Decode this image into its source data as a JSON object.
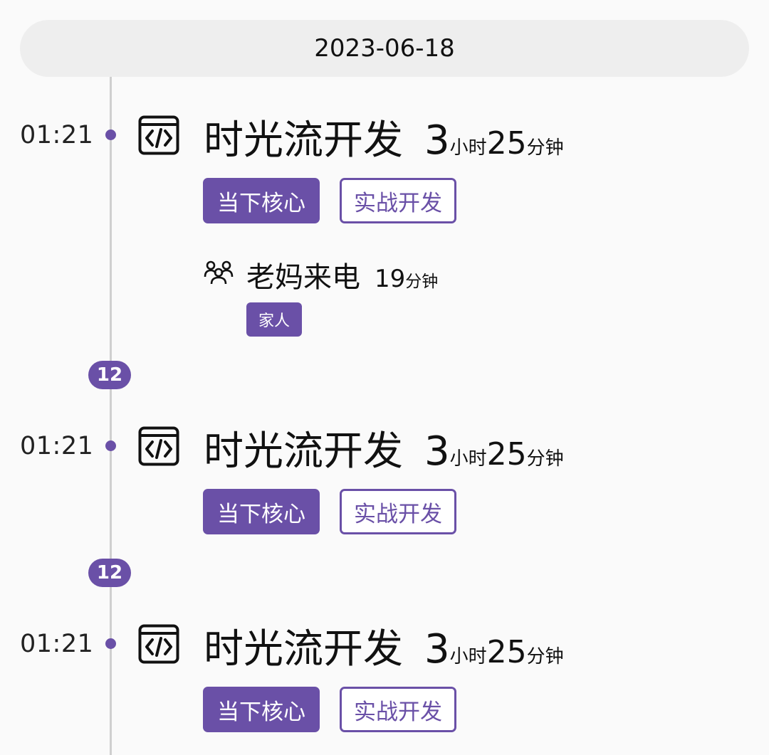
{
  "date_header": "2023-06-18",
  "entries": [
    {
      "time": "01:21",
      "icon": "code-window-icon",
      "title": "时光流开发",
      "duration_hours": "3",
      "hours_unit": "小时",
      "duration_minutes": "25",
      "minutes_unit": "分钟",
      "tags": [
        "当下核心",
        "实战开发"
      ],
      "sub_entry": {
        "icon": "people-icon",
        "title": "老妈来电",
        "duration_minutes": "19",
        "minutes_unit": "分钟",
        "tag": "家人"
      }
    },
    {
      "time": "01:21",
      "icon": "code-window-icon",
      "title": "时光流开发",
      "duration_hours": "3",
      "hours_unit": "小时",
      "duration_minutes": "25",
      "minutes_unit": "分钟",
      "tags": [
        "当下核心",
        "实战开发"
      ]
    },
    {
      "time": "01:21",
      "icon": "code-window-icon",
      "title": "时光流开发",
      "duration_hours": "3",
      "hours_unit": "小时",
      "duration_minutes": "25",
      "minutes_unit": "分钟",
      "tags": [
        "当下核心",
        "实战开发"
      ]
    }
  ],
  "gap_badges": [
    "12",
    "12"
  ],
  "colors": {
    "accent": "#6a50a7",
    "background": "#fafafa",
    "date_bar": "#eeeeee",
    "timeline": "#cfcfcf"
  }
}
